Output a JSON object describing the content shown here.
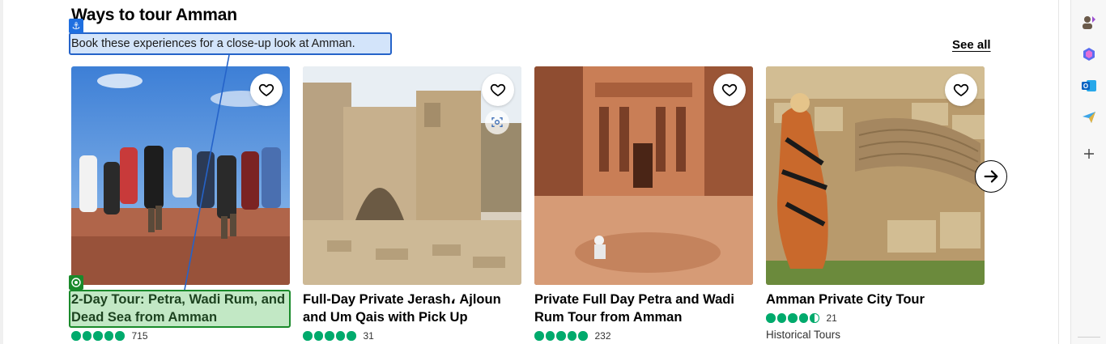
{
  "section": {
    "title": "Ways to tour Amman",
    "subtitle": "Book these experiences for a close-up look at Amman.",
    "see_all": "See all"
  },
  "cards": [
    {
      "title": "2-Day Tour: Petra, Wadi Rum, and Dead Sea from Amman",
      "rating": 5,
      "review_count": "715",
      "category": ""
    },
    {
      "title": "Full-Day Private Jerash، Ajloun and Um Qais with Pick Up",
      "rating": 5,
      "review_count": "31",
      "category": ""
    },
    {
      "title": "Private Full Day Petra and Wadi Rum Tour from Amman",
      "rating": 5,
      "review_count": "232",
      "category": ""
    },
    {
      "title": "Amman Private City Tour",
      "rating": 4.5,
      "review_count": "21",
      "category": "Historical Tours"
    }
  ],
  "icons": {
    "heart": "heart-outline-icon",
    "next": "arrow-right-icon",
    "lens": "visual-search-icon",
    "anchor": "anchor-icon",
    "target": "target-icon"
  },
  "sidebar": {
    "items": [
      "profile-icon",
      "copilot-icon",
      "outlook-icon",
      "send-icon",
      "add-icon"
    ]
  },
  "colors": {
    "rating_green": "#00aa6c",
    "anchor_blue": "#1f6fe0",
    "target_green": "#1a8a2b"
  }
}
